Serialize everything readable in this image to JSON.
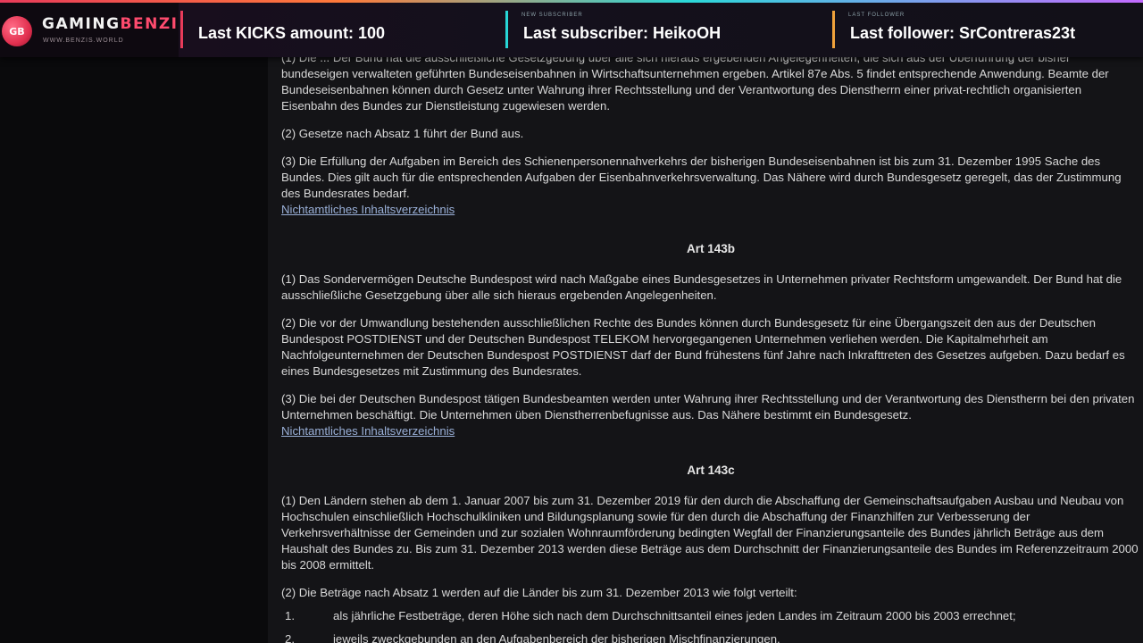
{
  "overlay": {
    "logo_badge": "GB",
    "brand_part1": "GAMING",
    "brand_part2": "BENZI",
    "brand_sub": "WWW.BENZIS.WORLD",
    "stats": {
      "kicks": {
        "caption": "",
        "value": "Last KICKS amount: 100"
      },
      "subscriber": {
        "caption": "NEW SUBSCRIBER",
        "value": "Last subscriber: HeikoOH"
      },
      "follower": {
        "caption": "LAST FOLLOWER",
        "value": "Last follower: SrContreras23t"
      }
    },
    "colors": {
      "kicks": "#e83b5a",
      "subscriber": "#27d6d6",
      "follower": "#f0a23b"
    }
  },
  "doc": {
    "p_top": "(1) Die ... Der Bund hat die ausschließliche Gesetzgebung über alle sich hieraus ergebenden Angelegenheiten, die sich aus der Überführung der bisher bundeseigen verwalteten geführten Bundeseisenbahnen in Wirtschaftsunternehmen ergeben. Artikel 87e Abs. 5 findet entsprechende Anwendung. Beamte der Bundeseisenbahnen können durch Gesetz unter Wahrung ihrer Rechtsstellung und der Verantwortung des Dienstherrn einer privat-rechtlich organisierten Eisenbahn des Bundes zur Dienstleistung zugewiesen werden.",
    "p_143a_2": "(2) Gesetze nach Absatz 1 führt der Bund aus.",
    "p_143a_3": "(3) Die Erfüllung der Aufgaben im Bereich des Schienenpersonennahverkehrs der bisherigen Bundeseisenbahnen ist bis zum 31. Dezember 1995 Sache des Bundes. Dies gilt auch für die entsprechenden Aufgaben der Eisenbahnverkehrsverwaltung. Das Nähere wird durch Bundesgesetz geregelt, das der Zustimmung des Bundesrates bedarf.",
    "toc_link_1": "Nichtamtliches Inhaltsverzeichnis",
    "art_143b_title": "Art 143b",
    "p_143b_1": "(1) Das Sondervermögen Deutsche Bundespost wird nach Maßgabe eines Bundesgesetzes in Unternehmen privater Rechtsform umgewandelt. Der Bund hat die ausschließliche Gesetzgebung über alle sich hieraus ergebenden Angelegenheiten.",
    "p_143b_2": "(2) Die vor der Umwandlung bestehenden ausschließlichen Rechte des Bundes können durch Bundesgesetz für eine Übergangszeit den aus der Deutschen Bundespost POSTDIENST und der Deutschen Bundespost TELEKOM hervorgegangenen Unternehmen verliehen werden. Die Kapitalmehrheit am Nachfolgeunternehmen der Deutschen Bundespost POSTDIENST darf der Bund frühestens fünf Jahre nach Inkrafttreten des Gesetzes aufgeben. Dazu bedarf es eines Bundesgesetzes mit Zustimmung des Bundesrates.",
    "p_143b_3": "(3) Die bei der Deutschen Bundespost tätigen Bundesbeamten werden unter Wahrung ihrer Rechtsstellung und der Verantwortung des Dienstherrn bei den privaten Unternehmen beschäftigt. Die Unternehmen üben Dienstherrenbefugnisse aus. Das Nähere bestimmt ein Bundesgesetz.",
    "toc_link_2": "Nichtamtliches Inhaltsverzeichnis",
    "art_143c_title": "Art 143c",
    "p_143c_1": "(1) Den Ländern stehen ab dem 1. Januar 2007 bis zum 31. Dezember 2019 für den durch die Abschaffung der Gemeinschaftsaufgaben Ausbau und Neubau von Hochschulen einschließlich Hochschulkliniken und Bildungsplanung sowie für den durch die Abschaffung der Finanzhilfen zur Verbesserung der Verkehrsverhältnisse der Gemeinden und zur sozialen Wohnraumförderung bedingten Wegfall der Finanzierungsanteile des Bundes jährlich Beträge aus dem Haushalt des Bundes zu. Bis zum 31. Dezember 2013 werden diese Beträge aus dem Durchschnitt der Finanzierungsanteile des Bundes im Referenzzeitraum 2000 bis 2008 ermittelt.",
    "p_143c_2": "(2) Die Beträge nach Absatz 1 werden auf die Länder bis zum 31. Dezember 2013 wie folgt verteilt:",
    "list": [
      {
        "num": "1.",
        "text": "als jährliche Festbeträge, deren Höhe sich nach dem Durchschnittsanteil eines jeden Landes im Zeitraum 2000 bis 2003 errechnet;"
      },
      {
        "num": "2.",
        "text": "jeweils zweckgebunden an den Aufgabenbereich der bisherigen Mischfinanzierungen."
      }
    ]
  }
}
